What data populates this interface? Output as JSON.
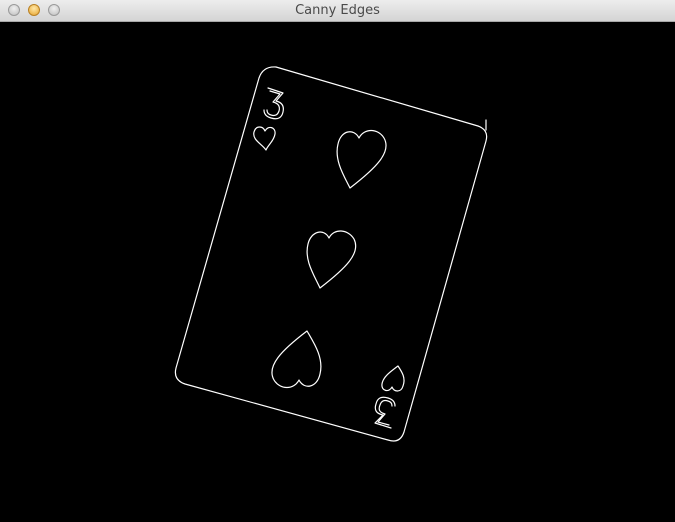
{
  "window": {
    "title": "Canny Edges"
  },
  "image": {
    "background_color": "#000000",
    "edge_color": "#ffffff",
    "card": {
      "rank": "3",
      "suit": "hearts"
    }
  }
}
